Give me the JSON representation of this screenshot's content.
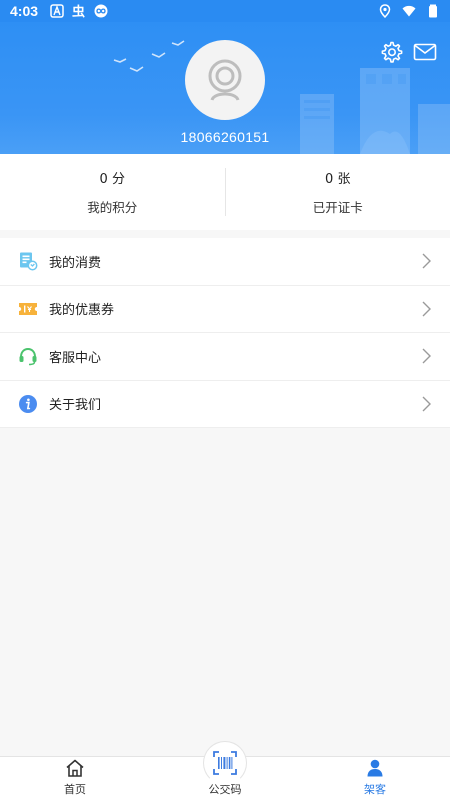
{
  "status_bar": {
    "time": "4:03",
    "left_icons": [
      "text-a-icon",
      "bug-icon",
      "infinity-icon"
    ],
    "right_icons": [
      "location-icon",
      "wifi-icon",
      "battery-icon"
    ]
  },
  "header": {
    "phone": "18066260151",
    "avatar": "avatar-placeholder-icon",
    "settings_icon": "gear-icon",
    "mail_icon": "mail-icon",
    "bg_color": "#2e8ff4"
  },
  "stats": [
    {
      "value": "0 分",
      "label": "我的积分"
    },
    {
      "value": "0 张",
      "label": "已开证卡"
    }
  ],
  "menu": [
    {
      "label": "我的消费",
      "icon": "consumption-icon"
    },
    {
      "label": "我的优惠券",
      "icon": "coupon-icon"
    },
    {
      "label": "客服中心",
      "icon": "headset-icon"
    },
    {
      "label": "关于我们",
      "icon": "info-icon"
    }
  ],
  "tabbar": {
    "tabs": [
      {
        "label": "首页",
        "icon": "home-icon",
        "active": false
      },
      {
        "label": "公交码",
        "icon": "barcode-icon",
        "active": false
      },
      {
        "label": "架客",
        "icon": "person-icon",
        "active": true
      }
    ],
    "active_color": "#2a7be4"
  }
}
